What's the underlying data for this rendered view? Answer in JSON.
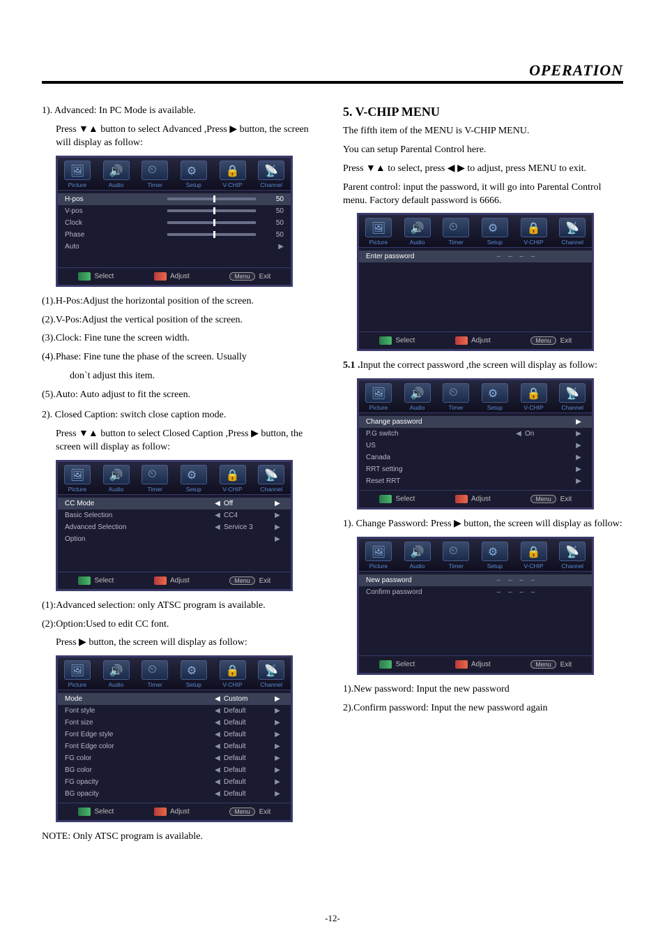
{
  "header": {
    "title": "OPERATION"
  },
  "left": {
    "advanced_heading": "1). Advanced: In  PC Mode is  available.",
    "advanced_press": "Press ▼▲ button to select  Advanced ,Press ▶ button, the screen will  display as follow:",
    "advanced_menu": {
      "tabs": [
        "Picture",
        "Audio",
        "Timer",
        "Setup",
        "V-CHIP",
        "Channel"
      ],
      "rows": [
        {
          "label": "H-pos",
          "type": "slider",
          "val": "50",
          "active": true
        },
        {
          "label": "V-pos",
          "type": "slider",
          "val": "50"
        },
        {
          "label": "Clock",
          "type": "slider",
          "val": "50"
        },
        {
          "label": "Phase",
          "type": "slider",
          "val": "50"
        },
        {
          "label": "Auto",
          "type": "arrow"
        }
      ],
      "footer": {
        "select": "Select",
        "adjust": "Adjust",
        "menu": "Menu",
        "exit": "Exit"
      }
    },
    "advanced_notes": [
      "(1).H-Pos:Adjust the horizontal position of the screen.",
      "(2).V-Pos:Adjust the vertical position of the screen.",
      "(3).Clock: Fine tune the screen width.",
      "(4).Phase: Fine tune the phase of the screen. Usually",
      "don`t adjust this item.",
      "(5).Auto: Auto adjust to fit the screen."
    ],
    "cc_heading": "2). Closed  Caption: switch close caption mode.",
    "cc_press": "Press ▼▲ button to select  Closed  Caption ,Press ▶ button, the screen will  display as follow:",
    "cc_menu": {
      "tabs": [
        "Picture",
        "Audio",
        "Timer",
        "Setup",
        "V-CHIP",
        "Channel"
      ],
      "rows": [
        {
          "label": "CC  Mode",
          "arrL": "◀",
          "val": "Off",
          "arrR": "▶",
          "active": true
        },
        {
          "label": "Basic Selection",
          "arrL": "◀",
          "val": "CC4",
          "arrR": "▶"
        },
        {
          "label": "Advanced Selection",
          "arrL": "◀",
          "val": "Service 3",
          "arrR": "▶"
        },
        {
          "label": "Option",
          "arrL": "",
          "val": "",
          "arrR": "▶"
        }
      ],
      "footer": {
        "select": "Select",
        "adjust": "Adjust",
        "menu": "Menu",
        "exit": "Exit"
      }
    },
    "cc_notes": [
      "(1):Advanced selection: only ATSC program is available.",
      "(2):Option:Used  to edit CC font."
    ],
    "cc_option_press": "Press  ▶  button, the screen will  display as follow:",
    "font_menu": {
      "tabs": [
        "Picture",
        "Audio",
        "Timer",
        "Setup",
        "V-CHIP",
        "Channel"
      ],
      "rows": [
        {
          "label": "Mode",
          "arrL": "◀",
          "val": "Custom",
          "arrR": "▶",
          "active": true
        },
        {
          "label": "Font style",
          "arrL": "◀",
          "val": "Default",
          "arrR": "▶"
        },
        {
          "label": "Font size",
          "arrL": "◀",
          "val": "Default",
          "arrR": "▶"
        },
        {
          "label": "Font Edge style",
          "arrL": "◀",
          "val": "Default",
          "arrR": "▶"
        },
        {
          "label": "Font Edge color",
          "arrL": "◀",
          "val": "Default",
          "arrR": "▶"
        },
        {
          "label": "FG color",
          "arrL": "◀",
          "val": "Default",
          "arrR": "▶"
        },
        {
          "label": "BG color",
          "arrL": "◀",
          "val": "Default",
          "arrR": "▶"
        },
        {
          "label": "FG opacity",
          "arrL": "◀",
          "val": "Default",
          "arrR": "▶"
        },
        {
          "label": "BG opacity",
          "arrL": "◀",
          "val": "Default",
          "arrR": "▶"
        }
      ],
      "footer": {
        "select": "Select",
        "adjust": "Adjust",
        "menu": "Menu",
        "exit": "Exit"
      }
    },
    "note_atsc": "NOTE: Only ATSC program is available."
  },
  "right": {
    "vchip_heading": "5.  V-CHIP  MENU",
    "vchip_intro1": "The fifth item of the MENU is V-CHIP MENU.",
    "vchip_intro2": "You can setup Parental Control here.",
    "vchip_intro3": "Press ▼▲ to select, press ◀ ▶  to adjust, press MENU to exit.",
    "vchip_intro4": "Parent control:   input the password, it will  go into Parental Control menu. Factory  default password is 6666.",
    "enter_menu": {
      "tabs": [
        "Picture",
        "Audio",
        "Timer",
        "Setup",
        "V-CHIP",
        "Channel"
      ],
      "rows": [
        {
          "label": "Enter password",
          "dashes": "– – – –",
          "active": true
        }
      ],
      "footer": {
        "select": "Select",
        "adjust": "Adjust",
        "menu": "Menu",
        "exit": "Exit"
      }
    },
    "five_one": "Input the correct password ,the screen will display as follow:",
    "five_one_prefix": "5.1 .",
    "settings_menu": {
      "tabs": [
        "Picture",
        "Audio",
        "Timer",
        "Setup",
        "V-CHIP",
        "Channel"
      ],
      "rows": [
        {
          "label": "Change password",
          "arrL": "",
          "val": "",
          "arrR": "▶",
          "active": true
        },
        {
          "label": "P.G switch",
          "arrL": "◀",
          "val": "On",
          "arrR": "▶"
        },
        {
          "label": "US",
          "arrL": "",
          "val": "",
          "arrR": "▶"
        },
        {
          "label": "Canada",
          "arrL": "",
          "val": "",
          "arrR": "▶"
        },
        {
          "label": "RRT setting",
          "arrL": "",
          "val": "",
          "arrR": "▶"
        },
        {
          "label": "Reset RRT",
          "arrL": "",
          "val": "",
          "arrR": "▶"
        }
      ],
      "footer": {
        "select": "Select",
        "adjust": "Adjust",
        "menu": "Menu",
        "exit": "Exit"
      }
    },
    "change_pw_intro": "1). Change Password: Press ▶ button, the screen will display as follow:",
    "newpw_menu": {
      "tabs": [
        "Picture",
        "Audio",
        "Timer",
        "Setup",
        "V-CHIP",
        "Channel"
      ],
      "rows": [
        {
          "label": "New password",
          "dashes": "– – – –",
          "active": true
        },
        {
          "label": "Confirm password",
          "dashes": "– – – –"
        }
      ],
      "footer": {
        "select": "Select",
        "adjust": "Adjust",
        "menu": "Menu",
        "exit": "Exit"
      }
    },
    "newpw_notes": [
      "1).New password: Input the  new password",
      "2).Confirm  password: Input the new password again"
    ]
  },
  "page_number": "-12-"
}
